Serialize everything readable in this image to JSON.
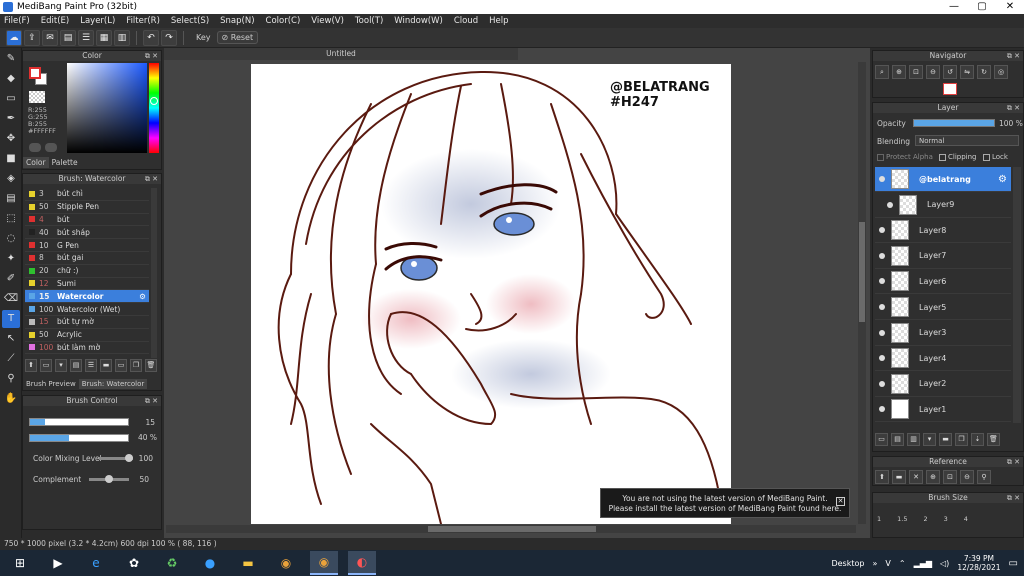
{
  "window": {
    "title": "MediBang Paint Pro (32bit)"
  },
  "menu": [
    "File(F)",
    "Edit(E)",
    "Layer(L)",
    "Filter(R)",
    "Select(S)",
    "Snap(N)",
    "Color(C)",
    "View(V)",
    "Tool(T)",
    "Window(W)",
    "Cloud",
    "Help"
  ],
  "toolbar": {
    "key_label": "Key",
    "reset_label": "Reset"
  },
  "color_panel": {
    "title": "Color",
    "rgb": [
      "R:255",
      "G:255",
      "B:255",
      "#FFFFFF"
    ],
    "tabs": [
      "Color",
      "Palette"
    ]
  },
  "brush_panel": {
    "title": "Brush: Watercolor",
    "items": [
      {
        "size": "3",
        "name": "bút chì",
        "color": "#e6d12c"
      },
      {
        "size": "50",
        "name": "Stipple Pen",
        "color": "#e6d12c"
      },
      {
        "size": "4",
        "name": "bút",
        "color": "#e03030",
        "dim": true
      },
      {
        "size": "40",
        "name": "bút sháp",
        "color": "#222222"
      },
      {
        "size": "10",
        "name": "G Pen",
        "color": "#e03030"
      },
      {
        "size": "8",
        "name": "bút gai",
        "color": "#e03030"
      },
      {
        "size": "20",
        "name": "chữ :)",
        "color": "#2fbf2f"
      },
      {
        "size": "12",
        "name": "Sumi",
        "color": "#e6d12c",
        "dim": true
      },
      {
        "size": "15",
        "name": "Watercolor",
        "color": "#5aa5e6",
        "selected": true
      },
      {
        "size": "100",
        "name": "Watercolor (Wet)",
        "color": "#5aa5e6"
      },
      {
        "size": "15",
        "name": "bút tự mờ",
        "color": "#bbbbbb",
        "dim": true
      },
      {
        "size": "50",
        "name": "Acrylic",
        "color": "#e6d12c"
      },
      {
        "size": "100",
        "name": "bút làm mờ",
        "color": "#e070e0",
        "dim": true
      }
    ],
    "tabs": [
      "Brush Preview",
      "Brush: Watercolor"
    ]
  },
  "brush_control": {
    "title": "Brush Control",
    "size_value": "15",
    "opacity_value": "40 %",
    "size_fraction": 0.15,
    "opacity_fraction": 0.4,
    "mixing_label": "Color Mixing Level",
    "mixing_value": "100",
    "complement_label": "Complement",
    "complement_value": "50"
  },
  "canvas": {
    "tab_title": "Untitled",
    "signature_line1": "@BELATRANG",
    "signature_line2": "#H247"
  },
  "notice": {
    "line1": "You are not using the latest version of MediBang Paint.",
    "line2": "Please install the latest version of MediBang Paint found here."
  },
  "navigator": {
    "title": "Navigator"
  },
  "layer_panel": {
    "title": "Layer",
    "opacity_label": "Opacity",
    "opacity_value": "100 %",
    "blending_label": "Blending",
    "blending_value": "Normal",
    "protect_alpha": "Protect Alpha",
    "clipping": "Clipping",
    "lock": "Lock",
    "layers": [
      {
        "name": "@belatrang",
        "selected": true
      },
      {
        "name": "Layer9",
        "indent": true
      },
      {
        "name": "Layer8"
      },
      {
        "name": "Layer7"
      },
      {
        "name": "Layer6"
      },
      {
        "name": "Layer5"
      },
      {
        "name": "Layer3"
      },
      {
        "name": "Layer4"
      },
      {
        "name": "Layer2"
      },
      {
        "name": "Layer1",
        "white": true
      }
    ]
  },
  "reference": {
    "title": "Reference"
  },
  "brush_size": {
    "title": "Brush Size",
    "values": [
      "1",
      "1.5",
      "2",
      "3",
      "4"
    ]
  },
  "status": {
    "text": "750 * 1000 pixel   (3.2 * 4.2cm)   600 dpi   100 %   ( 88, 116 )"
  },
  "taskbar": {
    "desktop_label": "Desktop",
    "lang": "V",
    "time": "7:39 PM",
    "date": "12/28/2021"
  }
}
